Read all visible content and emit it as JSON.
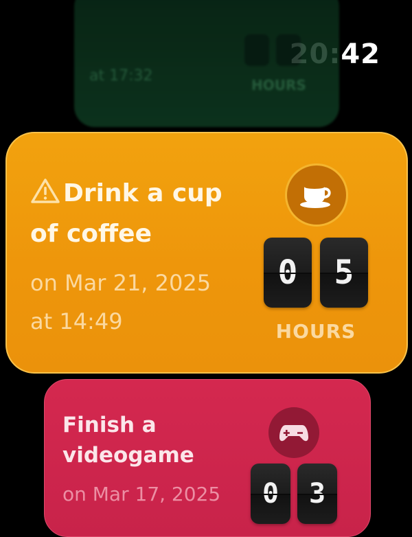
{
  "status_bar": {
    "time": "20:42"
  },
  "cards": {
    "previous": {
      "date_fragment": "at 17:32",
      "digits": [
        "",
        ""
      ],
      "unit": "HOURS",
      "color": "#0f3b22"
    },
    "current": {
      "warning_icon": "warning-triangle-icon",
      "title": "Drink a cup of coffee",
      "date_line1": "on Mar 21, 2025",
      "date_line2": "at 14:49",
      "app_icon": "coffee-cup-icon",
      "digits": [
        "0",
        "5"
      ],
      "unit": "HOURS",
      "color": "#f2a20e"
    },
    "next": {
      "title": "Finish a videogame",
      "date_line1": "on Mar 17, 2025",
      "app_icon": "gamepad-icon",
      "digits": [
        "0",
        "3"
      ],
      "color": "#d4284f"
    }
  }
}
